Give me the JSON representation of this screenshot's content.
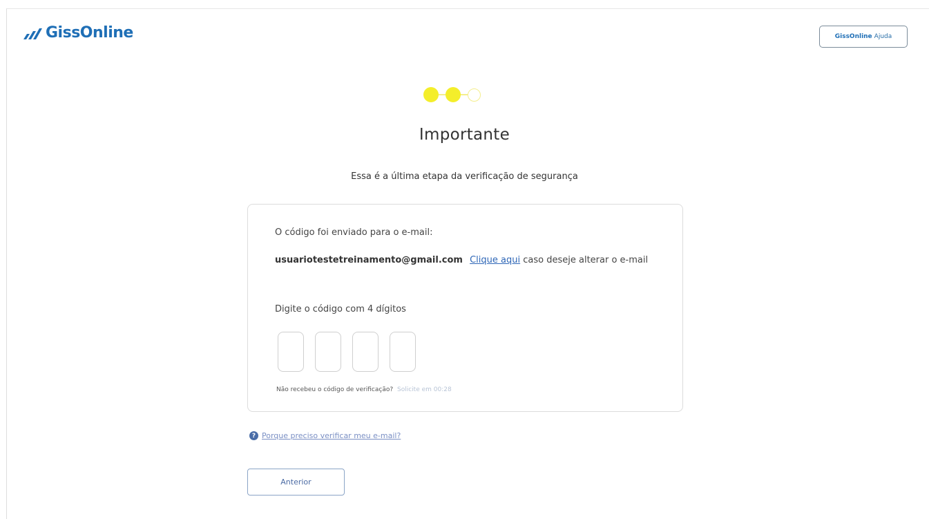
{
  "header": {
    "logo_text": "GissOnline",
    "help_button": {
      "brand": "GissOnline",
      "label": "Ajuda"
    }
  },
  "steps": {
    "total": 3,
    "completed": 2
  },
  "title": "Importante",
  "subtitle": "Essa é a última etapa da verificação de segurança",
  "card": {
    "sent_label": "O código foi enviado para o e-mail:",
    "email": "usuariotestetreinamento@gmail.com",
    "change_link": "Clique aqui",
    "change_text": "caso deseje alterar o e-mail",
    "digits_label": "Digite o código com 4 dígitos",
    "code_values": [
      "",
      "",
      "",
      ""
    ],
    "resend_question": "Não recebeu o código de verificação?",
    "resend_timer": "Solicite em 00:28"
  },
  "why_link": "Porque preciso verificar meu e-mail?",
  "prev_button": "Anterior",
  "colors": {
    "brand_blue": "#1f6fb6",
    "step_yellow": "#f4ee2b",
    "link_blue": "#2f67b7"
  }
}
